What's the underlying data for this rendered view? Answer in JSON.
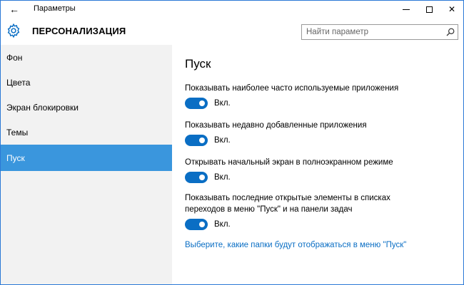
{
  "window": {
    "title": "Параметры",
    "back_glyph": "←",
    "close_glyph": "✕"
  },
  "header": {
    "icon": "gear-icon",
    "title": "ПЕРСОНАЛИЗАЦИЯ",
    "search_placeholder": "Найти параметр",
    "search_icon": "search-icon"
  },
  "sidebar": {
    "items": [
      {
        "label": "Фон"
      },
      {
        "label": "Цвета"
      },
      {
        "label": "Экран блокировки"
      },
      {
        "label": "Темы"
      },
      {
        "label": "Пуск",
        "active": true
      }
    ]
  },
  "main": {
    "title": "Пуск",
    "settings": [
      {
        "label": "Показывать наиболее часто используемые приложения",
        "state": "Вкл.",
        "on": true
      },
      {
        "label": "Показывать недавно добавленные приложения",
        "state": "Вкл.",
        "on": true
      },
      {
        "label": "Открывать начальный экран в полноэкранном режиме",
        "state": "Вкл.",
        "on": true
      },
      {
        "label": "Показывать последние открытые элементы в списках переходов в меню \"Пуск\" и на панели задач",
        "state": "Вкл.",
        "on": true
      }
    ],
    "link": "Выберите, какие папки будут отображаться в меню \"Пуск\""
  },
  "colors": {
    "accent": "#3a96dd",
    "toggle_on": "#0a6ec4",
    "link": "#0a6ec4",
    "sidebar_bg": "#f2f2f2",
    "window_border": "#2b79d6"
  }
}
